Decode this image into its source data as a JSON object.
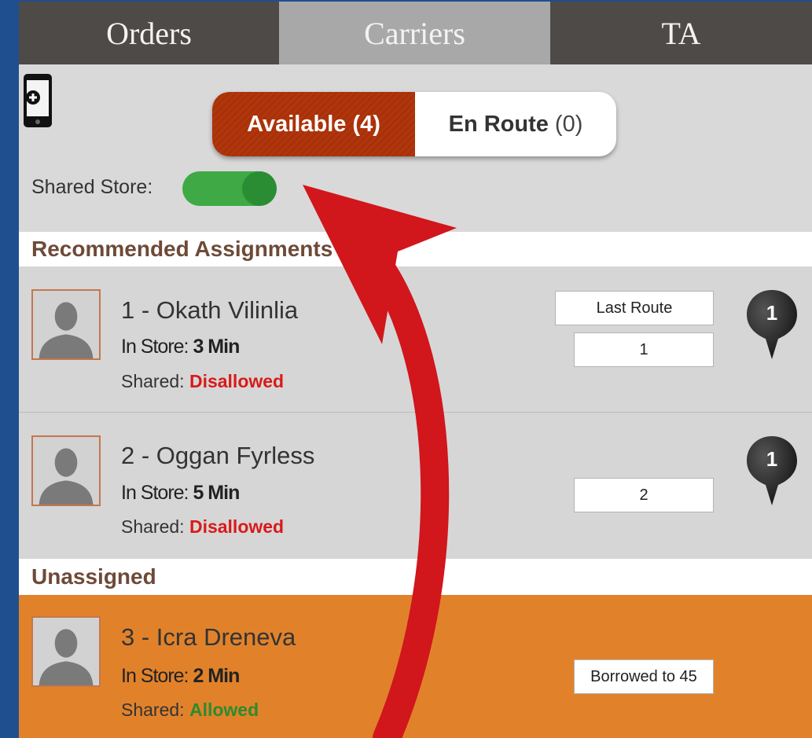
{
  "tabs": [
    {
      "label": "Orders",
      "active": false
    },
    {
      "label": "Carriers",
      "active": true
    },
    {
      "label": "TA",
      "active": false
    }
  ],
  "segment": {
    "available_label": "Available (4)",
    "enroute_label": "En Route",
    "enroute_count": "(0)"
  },
  "shared_store": {
    "label": "Shared Store:",
    "enabled": true
  },
  "sections": {
    "recommended": "Recommended Assignments",
    "unassigned": "Unassigned"
  },
  "carriers": [
    {
      "name": "1 - Okath Vilinlia",
      "instore_label": "In Store:",
      "instore_value": "3 Min",
      "shared_label": "Shared:",
      "shared_value": "Disallowed",
      "last_route_label": "Last Route",
      "route_value": "1",
      "pin_number": "1"
    },
    {
      "name": "2 - Oggan Fyrless",
      "instore_label": "In Store:",
      "instore_value": "5 Min",
      "shared_label": "Shared:",
      "shared_value": "Disallowed",
      "route_value": "2",
      "pin_number": "1"
    },
    {
      "name": "3 - Icra Dreneva",
      "instore_label": "In Store:",
      "instore_value": "2 Min",
      "shared_label": "Shared:",
      "shared_value": "Allowed",
      "route_value": "Borrowed to 45"
    }
  ],
  "colors": {
    "tab_dark": "#4e4a47",
    "tab_active": "#a8a8a8",
    "available_red": "#b0360b",
    "toggle_green": "#3faa45",
    "disallowed_red": "#d91a1a",
    "allowed_green": "#2d8b2d",
    "unassigned_orange": "#e1822b",
    "section_text_brown": "#6d4a38",
    "arrow_red": "#d1161c"
  }
}
